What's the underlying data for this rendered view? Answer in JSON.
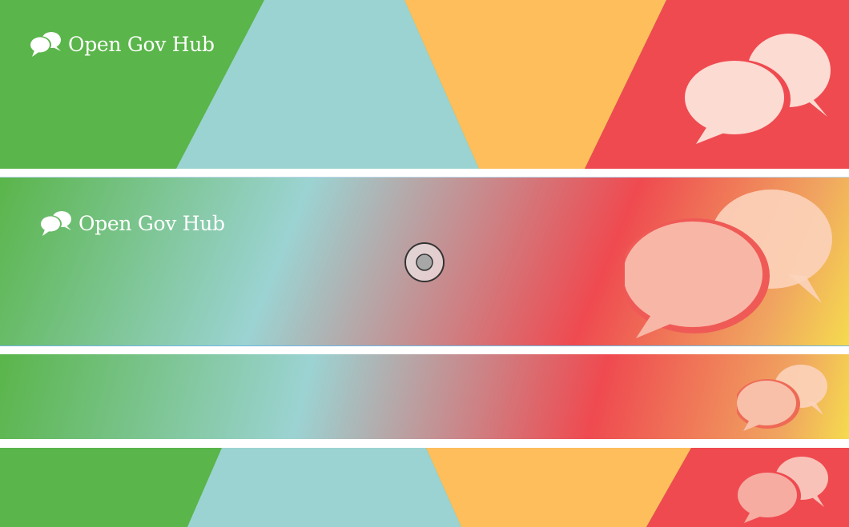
{
  "brand": {
    "name": "Open Gov Hub",
    "logo_icon": "speech-bubbles-icon"
  },
  "colors": {
    "green": "#5ab54a",
    "teal": "#9bd3d2",
    "orange": "#fdbe5b",
    "red": "#ef4a50",
    "yellow": "#f5db4e",
    "bubble": "#fcdbd2"
  },
  "banners": [
    {
      "style": "flat-stripes",
      "shows_brand": true
    },
    {
      "style": "gradient",
      "shows_brand": true
    },
    {
      "style": "gradient-thin",
      "shows_brand": false
    },
    {
      "style": "flat-stripes-thin",
      "shows_brand": false
    }
  ]
}
